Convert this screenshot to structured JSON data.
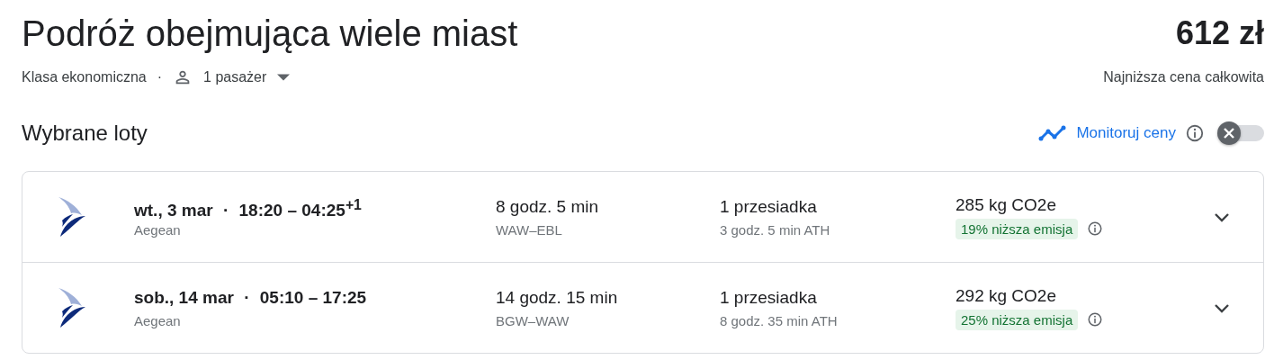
{
  "title": "Podróż obejmująca wiele miast",
  "price": "612 zł",
  "price_caption": "Najniższa cena całkowita",
  "cabin_class": "Klasa ekonomiczna",
  "separator": "·",
  "passengers": "1 pasażer",
  "section_title": "Wybrane loty",
  "track_prices": {
    "label": "Monitoruj ceny",
    "on": false
  },
  "flights": [
    {
      "date": "wt., 3 mar",
      "separator": "·",
      "times": "18:20 – 04:25$^{+1}$",
      "airline": "Aegean",
      "duration": "8 godz. 5 min",
      "route": "WAW–EBL",
      "stops": "1 przesiadka",
      "layover": "3 godz. 5 min ATH",
      "emissions": "285 kg CO2e",
      "emission_badge": "19% niższa emisja",
      "expanded": false
    },
    {
      "date": "sob., 14 mar",
      "separator": "·",
      "times": "05:10 – 17:25",
      "airline": "Aegean",
      "duration": "14 godz. 15 min",
      "route": "BGW–WAW",
      "stops": "1 przesiadka",
      "layover": "8 godz. 35 min ATH",
      "emissions": "292 kg CO2e",
      "emission_badge": "25% niższa emisja",
      "expanded": false
    }
  ]
}
